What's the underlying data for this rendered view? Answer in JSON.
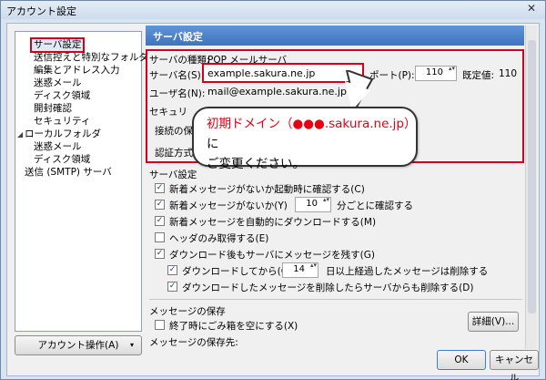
{
  "window": {
    "title": "アカウント設定",
    "close_glyph": "✕"
  },
  "tree": {
    "items": [
      {
        "label": "サーバ設定"
      },
      {
        "label": "送信控えと特別なフォルダ"
      },
      {
        "label": "編集とアドレス入力"
      },
      {
        "label": "迷惑メール"
      },
      {
        "label": "ディスク領域"
      },
      {
        "label": "開封確認"
      },
      {
        "label": "セキュリティ"
      },
      {
        "label": "ローカルフォルダ"
      },
      {
        "label": "迷惑メール"
      },
      {
        "label": "ディスク領域"
      },
      {
        "label": "送信 (SMTP) サーバ"
      }
    ],
    "expander_glyph": "◢"
  },
  "account_button": {
    "label": "アカウント操作(A)",
    "arrow": "▾"
  },
  "pane": {
    "header": "サーバ設定",
    "server_type_label": "サーバの種類:",
    "server_type_value": "POP メールサーバ",
    "server_name_label": "サーバ名(S):",
    "server_name_value": "example.sakura.ne.jp",
    "port_label": "ポート(P):",
    "port_value": "110",
    "default_label": "既定値:",
    "default_value": "110",
    "user_name_label": "ユーザ名(N):",
    "user_name_value": "mail@example.sakura.ne.jp",
    "security_label": "セキュリ",
    "connection_label": "接続の保",
    "auth_label": "認証方式",
    "server_settings_section": "サーバ設定",
    "checks": [
      {
        "label": "新着メッセージがないか起動時に確認する(C)",
        "checked": true
      },
      {
        "label": "新着メッセージがないか(Y)",
        "checked": true
      },
      {
        "label": "新着メッセージを自動的にダウンロードする(M)",
        "checked": true
      },
      {
        "label": "ヘッダのみ取得する(E)",
        "checked": false
      },
      {
        "label": "ダウンロード後もサーバにメッセージを残す(G)",
        "checked": true
      },
      {
        "label": "ダウンロードしてから(O)",
        "checked": true
      },
      {
        "label": "ダウンロードしたメッセージを削除したらサーバからも削除する(D)",
        "checked": true
      },
      {
        "label": "終了時にごみ箱を空にする(X)",
        "checked": false
      }
    ],
    "check_interval_value": "10",
    "check_interval_suffix": "分ごとに確認する",
    "keep_days_value": "14",
    "keep_days_suffix": "日以上経過したメッセージは削除する",
    "message_storage_section": "メッセージの保存",
    "details_button": "詳細(V)...",
    "storage_location_label": "メッセージの保存先:"
  },
  "callout": {
    "line1_red": "初期ドメイン（●●●.sakura.ne.jp）",
    "line1_black": "に",
    "line2": "ご変更ください。"
  },
  "buttons": {
    "ok": "OK",
    "cancel": "キャンセル"
  },
  "colors": {
    "highlight_red": "#d6001c",
    "header_blue": "#4a80c8",
    "callout_red": "#e60012"
  }
}
